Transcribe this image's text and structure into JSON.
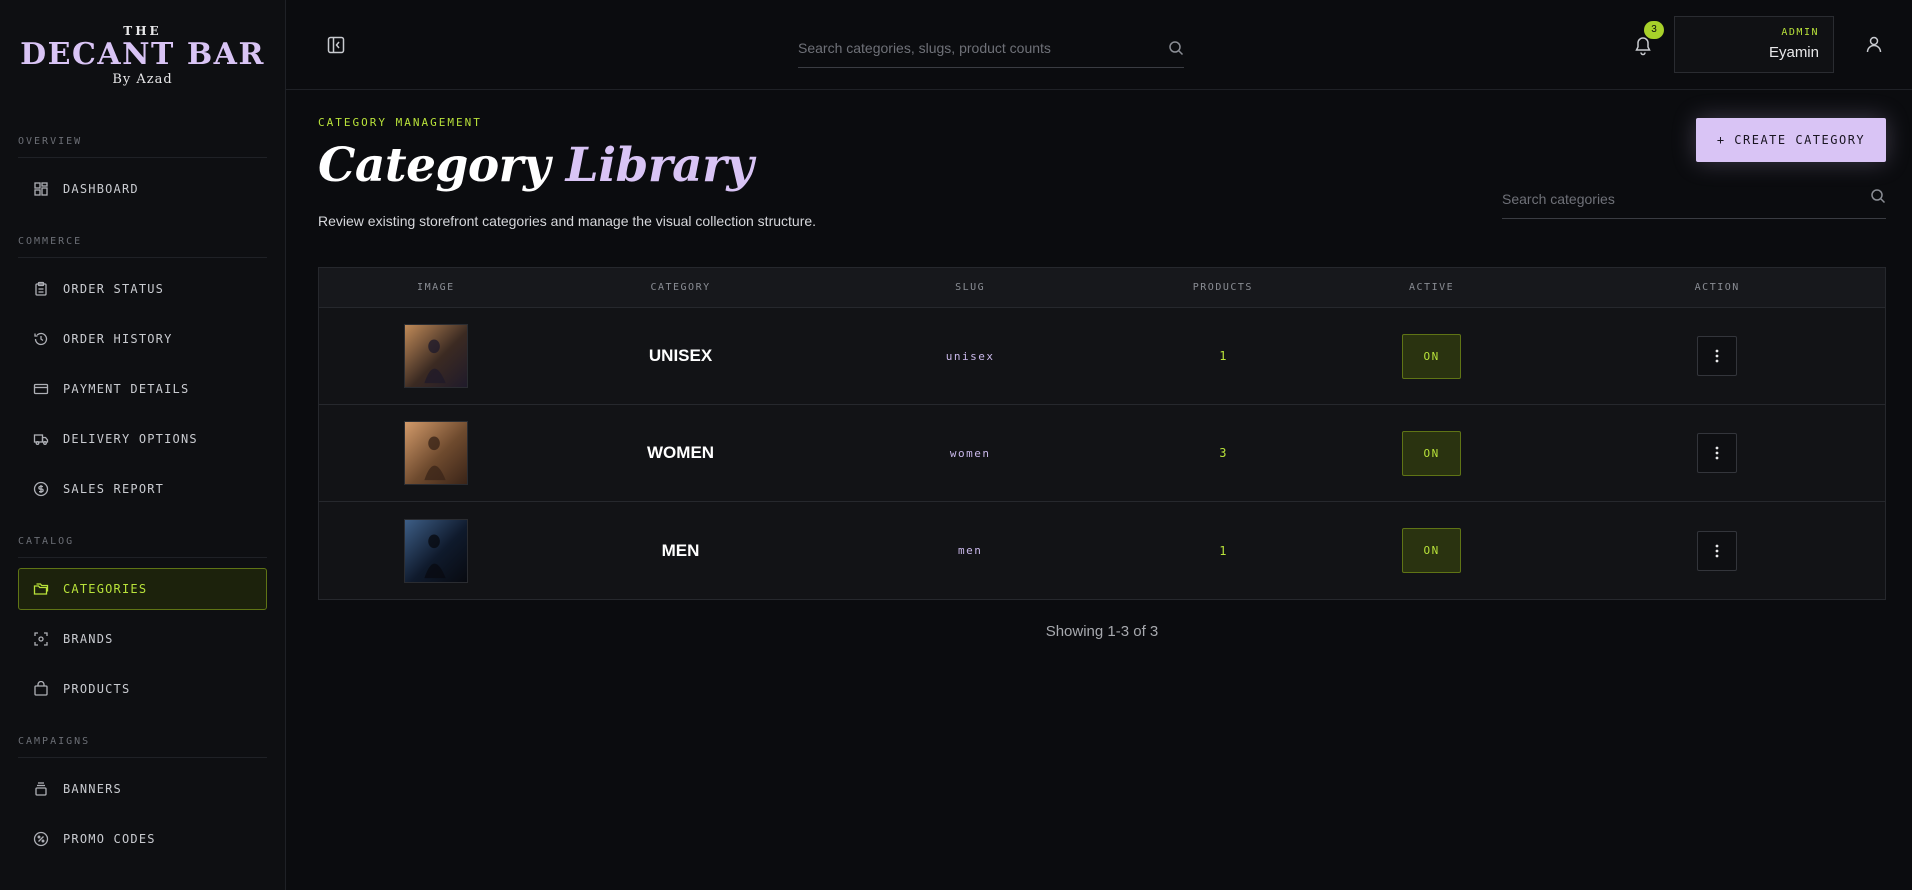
{
  "brand": {
    "the": "THE",
    "name": "DECANT BAR",
    "by": "By Azad"
  },
  "sidebar": {
    "sections": [
      {
        "title": "OVERVIEW",
        "items": [
          {
            "label": "DASHBOARD",
            "icon": "dashboard-icon"
          }
        ]
      },
      {
        "title": "COMMERCE",
        "items": [
          {
            "label": "ORDER STATUS",
            "icon": "clipboard-icon"
          },
          {
            "label": "ORDER HISTORY",
            "icon": "history-icon"
          },
          {
            "label": "PAYMENT DETAILS",
            "icon": "credit-card-icon"
          },
          {
            "label": "DELIVERY OPTIONS",
            "icon": "truck-icon"
          },
          {
            "label": "SALES REPORT",
            "icon": "dollar-circle-icon"
          }
        ]
      },
      {
        "title": "CATALOG",
        "items": [
          {
            "label": "CATEGORIES",
            "icon": "folders-icon",
            "active": true
          },
          {
            "label": "BRANDS",
            "icon": "scan-icon"
          },
          {
            "label": "PRODUCTS",
            "icon": "box-icon"
          }
        ]
      },
      {
        "title": "CAMPAIGNS",
        "items": [
          {
            "label": "BANNERS",
            "icon": "layers-icon"
          },
          {
            "label": "PROMO CODES",
            "icon": "percent-badge-icon"
          }
        ]
      }
    ]
  },
  "topbar": {
    "search_placeholder": "Search categories, slugs, product counts",
    "notification_count": "3",
    "admin_role": "ADMIN",
    "admin_name": "Eyamin"
  },
  "page": {
    "eyebrow": "CATEGORY MANAGEMENT",
    "title_main": "Category",
    "title_accent": "Library",
    "subtitle": "Review existing storefront categories and manage the visual collection structure.",
    "create_label": "+ CREATE CATEGORY",
    "search_placeholder": "Search categories"
  },
  "table": {
    "headers": [
      "IMAGE",
      "CATEGORY",
      "SLUG",
      "PRODUCTS",
      "ACTIVE",
      "ACTION"
    ],
    "rows": [
      {
        "category": "UNISEX",
        "slug": "unisex",
        "products": "1",
        "active": "ON",
        "image_colors": [
          "#3b2a22",
          "#c08a58",
          "#1f1a2a"
        ]
      },
      {
        "category": "WOMEN",
        "slug": "women",
        "products": "3",
        "active": "ON",
        "image_colors": [
          "#6e4a2e",
          "#d29a6a",
          "#3a2418"
        ]
      },
      {
        "category": "MEN",
        "slug": "men",
        "products": "1",
        "active": "ON",
        "image_colors": [
          "#0f1a2c",
          "#3d5e86",
          "#080a10"
        ]
      }
    ]
  },
  "pagination": {
    "showing": "Showing 1-3 of 3"
  },
  "colors": {
    "accent_lime": "#b9e33a",
    "accent_lavender": "#d9c4f5",
    "background": "#0b0c0f"
  }
}
